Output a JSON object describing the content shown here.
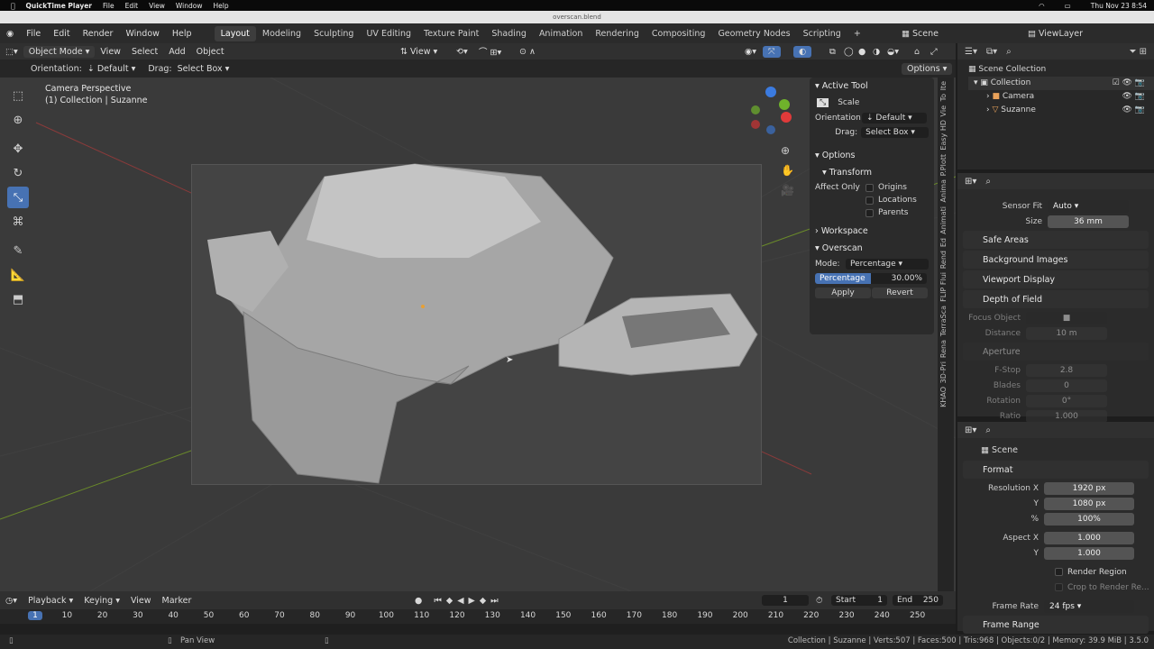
{
  "mac": {
    "app": "QuickTime Player",
    "menus": [
      "File",
      "Edit",
      "View",
      "Window",
      "Help"
    ],
    "clock": "Thu Nov 23  8:54"
  },
  "window_title": "overscan.blend",
  "topbar": {
    "menus": [
      "File",
      "Edit",
      "Render",
      "Window",
      "Help"
    ],
    "tabs": [
      "Layout",
      "Modeling",
      "Sculpting",
      "UV Editing",
      "Texture Paint",
      "Shading",
      "Animation",
      "Rendering",
      "Compositing",
      "Geometry Nodes",
      "Scripting"
    ],
    "scene": "Scene",
    "viewlayer": "ViewLayer"
  },
  "header": {
    "mode": "Object Mode",
    "menus": [
      "View",
      "Select",
      "Add",
      "Object"
    ],
    "view": "View",
    "options": "Options"
  },
  "opts": {
    "orientation_label": "Orientation:",
    "orientation": "Default",
    "drag_label": "Drag:",
    "drag": "Select Box"
  },
  "viewport": {
    "line1": "Camera Perspective",
    "line2": "(1) Collection | Suzanne"
  },
  "npanel": {
    "active_tool": "Active Tool",
    "tool": "Scale",
    "orientation_label": "Orientation",
    "orientation": "Default",
    "drag_label": "Drag:",
    "drag": "Select Box",
    "options": "Options",
    "transform": "Transform",
    "affect_only": "Affect Only",
    "origins": "Origins",
    "locations": "Locations",
    "parents": "Parents",
    "workspace": "Workspace",
    "overscan": "Overscan",
    "mode_label": "Mode:",
    "mode": "Percentage",
    "pct_label": "Percentage",
    "pct_value": "30.00%",
    "apply": "Apply",
    "revert": "Revert"
  },
  "sidetabs": [
    "Ite",
    "To",
    "Vie",
    "Easy HD",
    "P.Plott",
    "Anima",
    "Animati",
    "Ed",
    "Rend",
    "FLIP Flui",
    "TerraSca",
    "Rena",
    "3D-Pri",
    "KHAO"
  ],
  "outliner": {
    "root": "Scene Collection",
    "collection": "Collection",
    "camera": "Camera",
    "suzanne": "Suzanne"
  },
  "cam_props": {
    "sensor_fit_label": "Sensor Fit",
    "sensor_fit": "Auto",
    "size_label": "Size",
    "size": "36 mm",
    "safe_areas": "Safe Areas",
    "bg_images": "Background Images",
    "viewport_display": "Viewport Display",
    "dof": "Depth of Field",
    "focus_object": "Focus Object",
    "distance_label": "Distance",
    "distance": "10 m",
    "aperture": "Aperture",
    "fstop_label": "F-Stop",
    "fstop": "2.8",
    "blades_label": "Blades",
    "blades": "0",
    "rotation_label": "Rotation",
    "rotation": "0°",
    "ratio_label": "Ratio",
    "ratio": "1.000"
  },
  "scene_props": {
    "scene": "Scene",
    "format": "Format",
    "resx_label": "Resolution X",
    "resx": "1920 px",
    "resy_label": "Y",
    "resy": "1080 px",
    "pct_label": "%",
    "pct": "100%",
    "aspx_label": "Aspect X",
    "aspx": "1.000",
    "aspy_label": "Y",
    "aspy": "1.000",
    "render_region": "Render Region",
    "crop": "Crop to Render Re...",
    "fps_label": "Frame Rate",
    "fps": "24 fps",
    "frame_range": "Frame Range"
  },
  "timeline": {
    "menus": [
      "Playback",
      "Keying",
      "View",
      "Marker"
    ],
    "current": "1",
    "start_label": "Start",
    "start": "1",
    "end_label": "End",
    "end": "250",
    "ticks": [
      "1",
      "10",
      "20",
      "30",
      "40",
      "50",
      "60",
      "70",
      "80",
      "90",
      "100",
      "110",
      "120",
      "130",
      "140",
      "150",
      "160",
      "170",
      "180",
      "190",
      "200",
      "210",
      "220",
      "230",
      "240",
      "250"
    ]
  },
  "status": {
    "left": "Pan View",
    "right": "Collection | Suzanne | Verts:507 | Faces:500 | Tris:968 | Objects:0/2 | Memory: 39.9 MiB | 3.5.0"
  }
}
